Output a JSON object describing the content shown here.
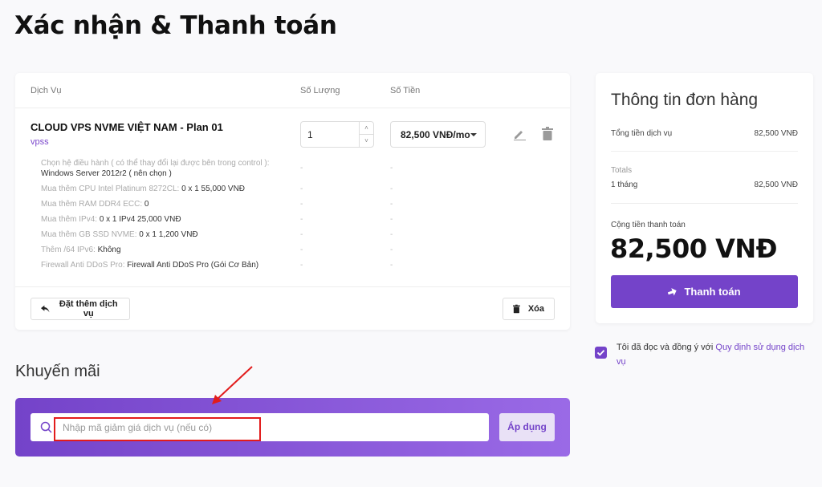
{
  "page": {
    "title": "Xác nhận & Thanh toán"
  },
  "cart": {
    "headers": {
      "service": "Dịch Vụ",
      "quantity": "Số Lượng",
      "amount": "Số Tiền"
    },
    "product": {
      "name": "CLOUD VPS NVME VIỆT NAM - Plan 01",
      "group": "vpss",
      "quantity": "1",
      "price": "82,500 VNĐ/mo"
    },
    "config": [
      {
        "label": "Chọn hệ điều hành ( có thể thay đổi lại được bên trong control ):",
        "value": "Windows Server 2012r2 ( nên chọn )",
        "qty": "-",
        "amount": "-"
      },
      {
        "label": "Mua thêm CPU Intel Platinum 8272CL:",
        "value": "0 x 1 55,000 VNĐ",
        "qty": "-",
        "amount": "-"
      },
      {
        "label": "Mua thêm RAM DDR4 ECC:",
        "value": "0",
        "qty": "-",
        "amount": "-"
      },
      {
        "label": "Mua thêm IPv4:",
        "value": "0 x 1 IPv4 25,000 VNĐ",
        "qty": "-",
        "amount": "-"
      },
      {
        "label": "Mua thêm GB SSD NVME:",
        "value": "0 x 1 1,200 VNĐ",
        "qty": "-",
        "amount": "-"
      },
      {
        "label": "Thêm /64 IPv6:",
        "value": "Không",
        "qty": "-",
        "amount": "-"
      },
      {
        "label": "Firewall Anti DDoS Pro:",
        "value": "Firewall Anti DDoS Pro (Gói Cơ Bản)",
        "qty": "-",
        "amount": "-"
      }
    ],
    "add_service_label": "Đặt thêm dịch vụ",
    "delete_label": "Xóa"
  },
  "promo": {
    "title": "Khuyến mãi",
    "placeholder": "Nhập mã giảm giá dịch vụ (nếu có)",
    "apply_label": "Áp dụng"
  },
  "order": {
    "title": "Thông tin đơn hàng",
    "subtotal_label": "Tổng tiền dịch vụ",
    "subtotal_value": "82,500 VNĐ",
    "totals_label": "Totals",
    "period_label": "1 tháng",
    "period_value": "82,500 VNĐ",
    "pay_label": "Cộng tiền thanh toán",
    "pay_total": "82,500 VNĐ",
    "checkout_label": "Thanh toán"
  },
  "agreement": {
    "text": "Tôi đã đọc và đồng ý với ",
    "link": "Quy định sử dụng dịch vụ",
    "checked": true
  },
  "colors": {
    "accent": "#7443c9",
    "annotation": "#e21c1c"
  }
}
